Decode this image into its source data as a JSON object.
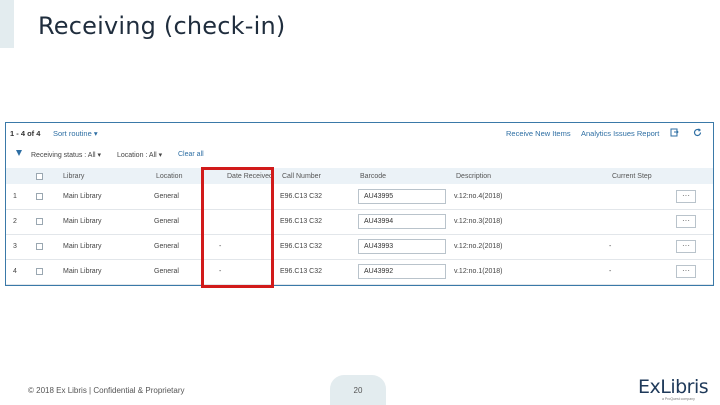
{
  "slide": {
    "title": "Receiving (check-in)",
    "footer": "© 2018 Ex Libris | Confidential & Proprietary",
    "page_number": "20"
  },
  "toolbar": {
    "count": "1 - 4 of 4",
    "sort_label": "Sort routine ▾",
    "receive_link": "Receive New Items",
    "report_link": "Analytics Issues Report"
  },
  "filters": {
    "receiving_status": "Receiving status : All ▾",
    "location": "Location : All ▾",
    "clear": "Clear all"
  },
  "table": {
    "headers": [
      "Library",
      "Location",
      "Date Received",
      "Call Number",
      "Barcode",
      "Description",
      "Current Step"
    ],
    "rows": [
      {
        "num": "1",
        "library": "Main Library",
        "location": "General",
        "date": "",
        "call": "E96.C13 C32",
        "barcode": "AU43995",
        "description": "v.12:no.4(2018)",
        "step": "",
        "more": "···"
      },
      {
        "num": "2",
        "library": "Main Library",
        "location": "General",
        "date": "",
        "call": "E96.C13 C32",
        "barcode": "AU43994",
        "description": "v.12:no.3(2018)",
        "step": "",
        "more": "···"
      },
      {
        "num": "3",
        "library": "Main Library",
        "location": "General",
        "date": "-",
        "call": "E96.C13 C32",
        "barcode": "AU43993",
        "description": "v.12:no.2(2018)",
        "step": "-",
        "more": "···"
      },
      {
        "num": "4",
        "library": "Main Library",
        "location": "General",
        "date": "-",
        "call": "E96.C13 C32",
        "barcode": "AU43992",
        "description": "v.12:no.1(2018)",
        "step": "-",
        "more": "···"
      }
    ]
  },
  "logo": {
    "text": "ExLibris",
    "subtext": "a ProQuest company"
  },
  "colors": {
    "highlight": "#d11a1a",
    "link": "#2d6ea3",
    "header_bg": "#ebf2f7"
  },
  "icons": [
    "filter-icon",
    "export-icon",
    "refresh-icon"
  ]
}
